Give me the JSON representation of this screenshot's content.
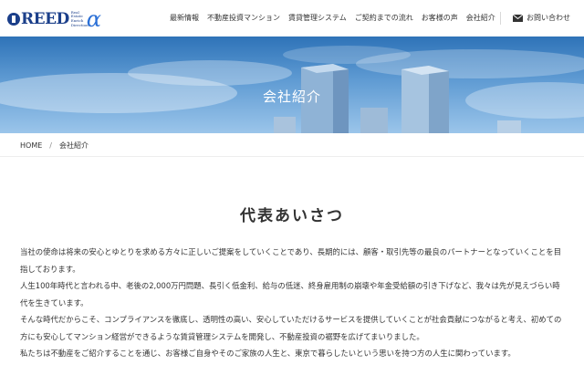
{
  "header": {
    "logo": {
      "main": "REED",
      "sub": [
        "Real",
        "Estate",
        "Enrich",
        "Direction"
      ],
      "alpha": "α"
    },
    "nav": [
      "最新情報",
      "不動産投資マンション",
      "賃貸管理システム",
      "ご契約までの流れ",
      "お客様の声",
      "会社紹介"
    ],
    "contact_label": "お問い合わせ",
    "contact_icon": "mail-icon"
  },
  "hero": {
    "title": "会社紹介"
  },
  "breadcrumb": {
    "home": "HOME",
    "separator": "/",
    "current": "会社紹介"
  },
  "main": {
    "heading": "代表あいさつ",
    "paragraphs": [
      "当社の使命は将来の安心とゆとりを求める方々に正しいご提案をしていくことであり、長期的には、顧客・取引先等の最良のパートナーとなっていくことを目指しております。",
      "人生100年時代と言われる中、老後の2,000万円問題、長引く低金利、給与の低迷、終身雇用制の崩壊や年金受給額の引き下げなど、我々は先が見えづらい時代を生きています。",
      "そんな時代だからこそ、コンプライアンスを徹底し、透明性の高い、安心していただけるサービスを提供していくことが社会貢献につながると考え、初めての方にも安心してマンション経営ができるような賃貸管理システムを開発し、不動産投資の裾野を広げてまいりました。",
      "私たちは不動産をご紹介することを通じ、お客様ご自身やそのご家族の人生と、東京で暮らしたいという思いを持つ方の人生に関わっています。"
    ]
  },
  "colors": {
    "brand": "#1b3f8a",
    "accent": "#2a6fd6",
    "sky_top": "#2e73b8",
    "sky_bottom": "#9bc5ea"
  }
}
